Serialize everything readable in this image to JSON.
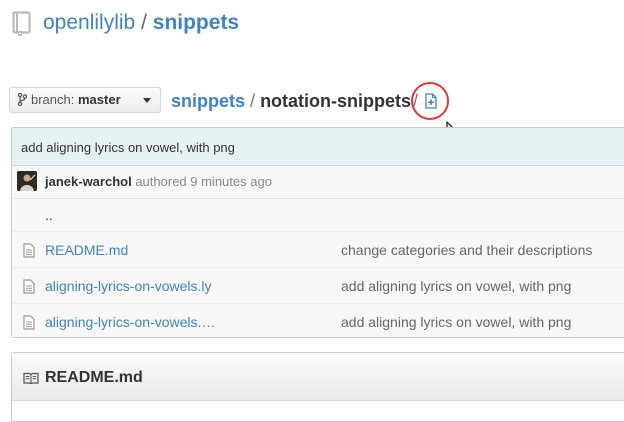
{
  "repo": {
    "owner": "openlilylib",
    "separator": "/",
    "name": "snippets"
  },
  "branch": {
    "label": "branch:",
    "value": "master"
  },
  "breadcrumb": {
    "root": "snippets",
    "separator": "/",
    "current": "notation-snippets",
    "trailing_separator": "/"
  },
  "commit": {
    "message": "add aligning lyrics on vowel, with png",
    "author": "janek-warchol",
    "authored_text": "authored 9 minutes ago"
  },
  "files": {
    "parent_dir": "..",
    "items": [
      {
        "name": "README.md",
        "message": "change categories and their descriptions"
      },
      {
        "name": "aligning-lyrics-on-vowels.ly",
        "message": "add aligning lyrics on vowel, with png"
      },
      {
        "name": "aligning-lyrics-on-vowels.…",
        "message": "add aligning lyrics on vowel, with png"
      }
    ]
  },
  "readme": {
    "title": "README.md"
  },
  "icons": {
    "repo": "repo-icon",
    "branch": "git-branch-icon",
    "new_file": "new-file-icon",
    "file": "file-text-icon",
    "book": "book-icon",
    "cursor": "mouse-pointer-icon"
  },
  "colors": {
    "link": "#4183c4",
    "commit_bar": "#e6f1f6",
    "highlight": "#e0383f"
  }
}
